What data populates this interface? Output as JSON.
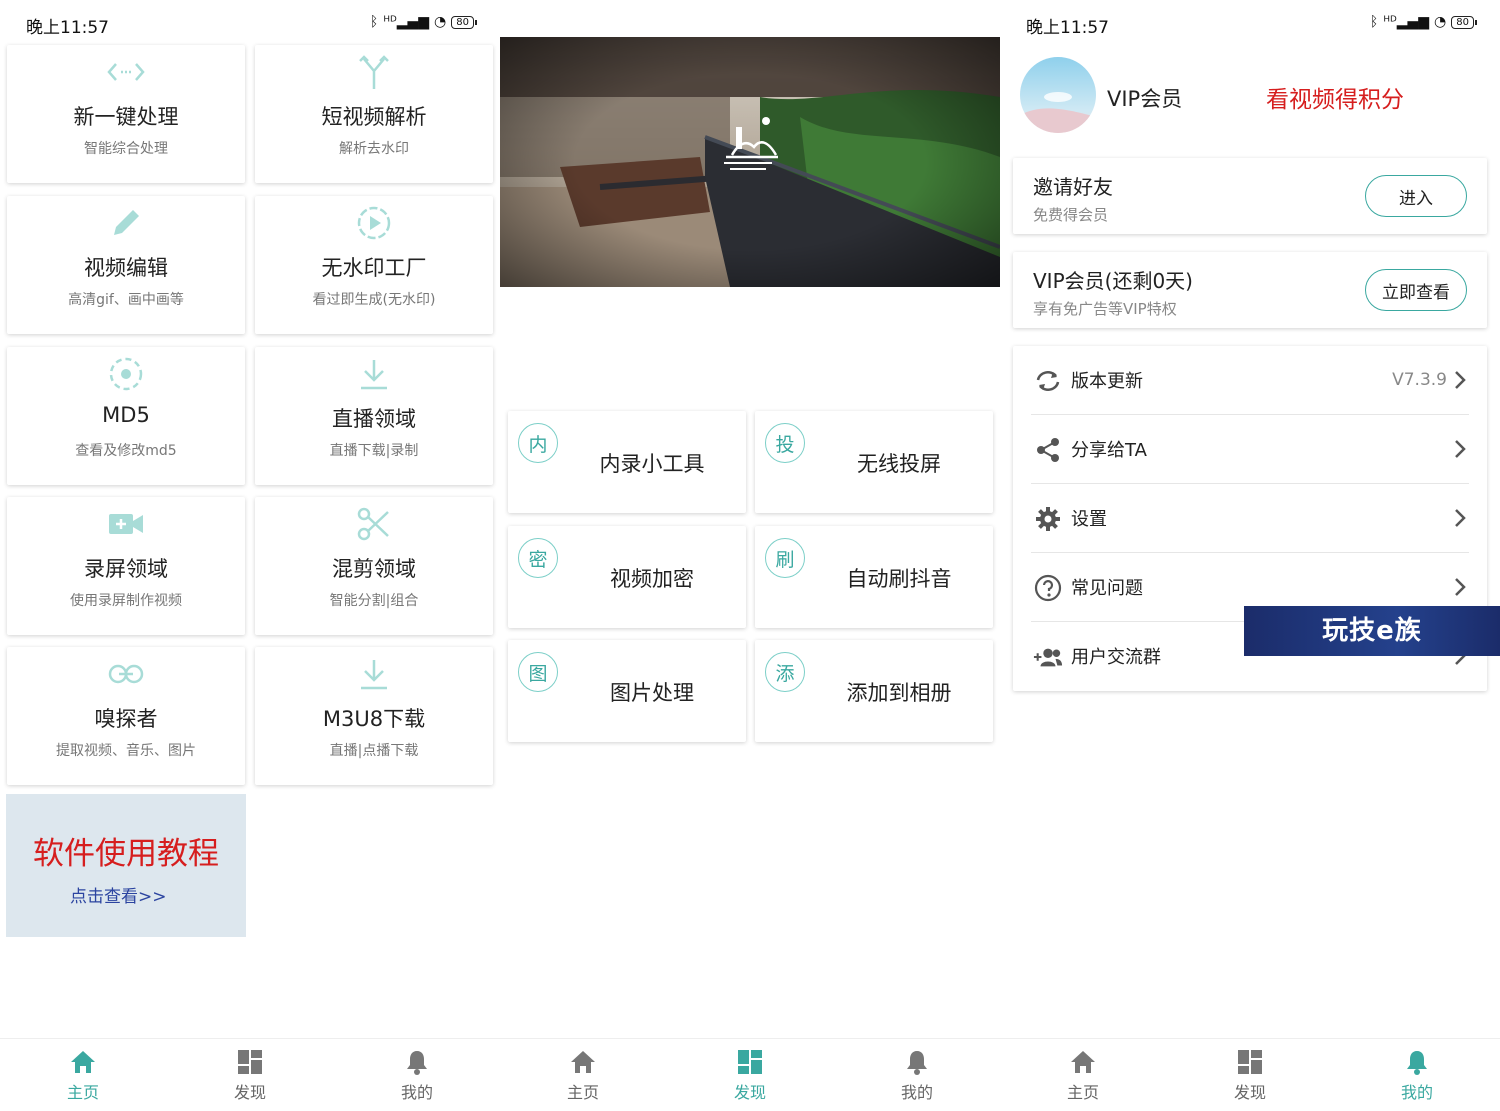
{
  "status": {
    "time": "晚上11:57",
    "signal": "ᴴᴰ",
    "battery": "80"
  },
  "home": {
    "tiles": [
      {
        "title": "新一键处理",
        "sub": "智能综合处理",
        "icon": "code-arrows-icon"
      },
      {
        "title": "短视频解析",
        "sub": "解析去水印",
        "icon": "split-arrows-icon"
      },
      {
        "title": "视频编辑",
        "sub": "高清gif、画中画等",
        "icon": "pencil-icon"
      },
      {
        "title": "无水印工厂",
        "sub": "看过即生成(无水印)",
        "icon": "play-circle-icon"
      },
      {
        "title": "MD5",
        "sub": "查看及修改md5",
        "icon": "dotted-circle-icon"
      },
      {
        "title": "直播领域",
        "sub": "直播下载|录制",
        "icon": "download-icon"
      },
      {
        "title": "录屏领域",
        "sub": "使用录屏制作视频",
        "icon": "video-plus-icon"
      },
      {
        "title": "混剪领域",
        "sub": "智能分割|组合",
        "icon": "scissors-icon"
      },
      {
        "title": "嗅探者",
        "sub": "提取视频、音乐、图片",
        "icon": "link-icon"
      },
      {
        "title": "M3U8下载",
        "sub": "直播|点播下载",
        "icon": "download-icon"
      }
    ],
    "tutorial": {
      "title": "软件使用教程",
      "link": "点击查看>>"
    }
  },
  "discover": {
    "tools": [
      {
        "badge": "内",
        "label": "内录小工具"
      },
      {
        "badge": "投",
        "label": "无线投屏"
      },
      {
        "badge": "密",
        "label": "视频加密"
      },
      {
        "badge": "刷",
        "label": "自动刷抖音"
      },
      {
        "badge": "图",
        "label": "图片处理"
      },
      {
        "badge": "添",
        "label": "添加到相册"
      }
    ]
  },
  "mine": {
    "vip_label": "VIP会员",
    "promo": "看视频得积分",
    "invite": {
      "title": "邀请好友",
      "sub": "免费得会员",
      "button": "进入"
    },
    "vip": {
      "title": "VIP会员(还剩0天)",
      "sub": "享有免广告等VIP特权",
      "button": "立即查看"
    },
    "settings": [
      {
        "label": "版本更新",
        "value": "V7.3.9",
        "icon": "refresh-icon"
      },
      {
        "label": "分享给TA",
        "value": "",
        "icon": "share-icon"
      },
      {
        "label": "设置",
        "value": "",
        "icon": "gear-icon"
      },
      {
        "label": "常见问题",
        "value": "",
        "icon": "question-icon"
      },
      {
        "label": "用户交流群",
        "value": "",
        "icon": "add-group-icon"
      }
    ],
    "watermark": "玩技e族"
  },
  "nav": {
    "home": "主页",
    "discover": "发现",
    "mine": "我的"
  },
  "colors": {
    "accent": "#3aa8a0",
    "icon_light": "#a8dcd7",
    "nav_gray": "#777777",
    "red": "#d61e1e",
    "tutorial_bg": "#dde7ee"
  }
}
